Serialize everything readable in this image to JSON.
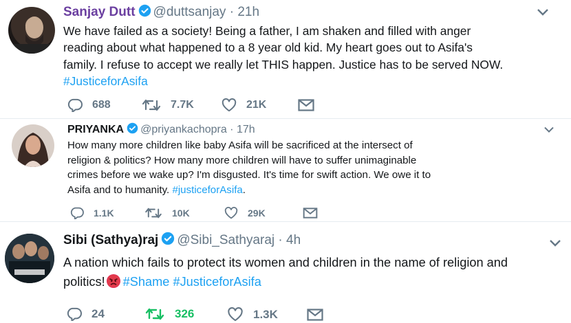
{
  "tweets": [
    {
      "name": "Sanjay Dutt",
      "handle": "@duttsanjay",
      "time": "21h",
      "lines": [
        "We have failed as a society! Being a father, I am shaken and filled with anger",
        "reading about what happened to a 8 year old kid. My heart goes out to Asifa's",
        "family. I refuse to accept we really let THIS happen. Justice has to be served NOW."
      ],
      "hashtag": "#JusticeforAsifa",
      "replies": "688",
      "retweets": "7.7K",
      "likes": "21K"
    },
    {
      "name": "PRIYANKA",
      "handle": "@priyankachopra",
      "time": "17h",
      "lines": [
        "How many more children like baby Asifa will be sacrificed at the intersect of",
        "religion & politics? How many more children will have to suffer unimaginable",
        "crimes before we wake up? I'm disgusted. It's time for swift action. We owe it to",
        "Asifa and to humanity."
      ],
      "hashtag": "#justiceforAsifa",
      "hashtag_suffix": ".",
      "replies": "1.1K",
      "retweets": "10K",
      "likes": "29K"
    },
    {
      "name": "Sibi (Sathya)raj",
      "handle": "@Sibi_Sathyaraj",
      "time": "4h",
      "lines": [
        "A nation which fails to protect its women and children in the name of religion and",
        "politics!"
      ],
      "hashtag_1": "#Shame",
      "hashtag_2": "#JusticeforAsifa",
      "replies": "24",
      "retweets": "326",
      "likes": "1.3K"
    }
  ],
  "icons": {
    "verified": "verified-badge-icon",
    "reply": "reply-icon",
    "retweet": "retweet-icon",
    "like": "heart-icon",
    "dm": "envelope-icon",
    "caret": "chevron-down-icon",
    "emoji": "angry-face-emoji"
  },
  "colors": {
    "name": "#6b3fa0",
    "hashtag": "#1da1f2",
    "meta": "#657786",
    "retweeted": "#17bf63",
    "verified": "#1da1f2"
  }
}
